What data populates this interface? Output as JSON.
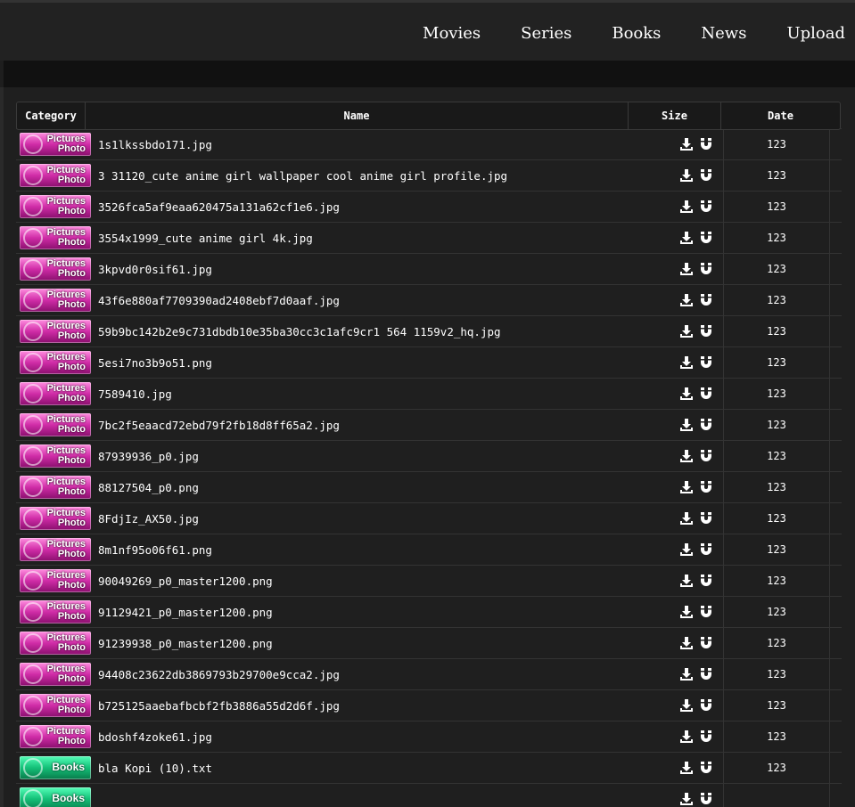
{
  "nav": {
    "items": [
      "Movies",
      "Series",
      "Books",
      "News",
      "Upload"
    ]
  },
  "table": {
    "headers": {
      "category": "Category",
      "name": "Name",
      "size": "Size",
      "date": "Date"
    },
    "badges": {
      "pictures": [
        "Pictures",
        "Photo"
      ],
      "books": "Books"
    },
    "rows": [
      {
        "category": "pictures",
        "name": "1s1lkssbdo171.jpg",
        "date": "123"
      },
      {
        "category": "pictures",
        "name": "3 31120_cute anime girl wallpaper cool anime girl profile.jpg",
        "date": "123"
      },
      {
        "category": "pictures",
        "name": "3526fca5af9eaa620475a131a62cf1e6.jpg",
        "date": "123"
      },
      {
        "category": "pictures",
        "name": "3554x1999_cute anime girl 4k.jpg",
        "date": "123"
      },
      {
        "category": "pictures",
        "name": "3kpvd0r0sif61.jpg",
        "date": "123"
      },
      {
        "category": "pictures",
        "name": "43f6e880af7709390ad2408ebf7d0aaf.jpg",
        "date": "123"
      },
      {
        "category": "pictures",
        "name": "59b9bc142b2e9c731dbdb10e35ba30cc3c1afc9cr1 564 1159v2_hq.jpg",
        "date": "123"
      },
      {
        "category": "pictures",
        "name": "5esi7no3b9o51.png",
        "date": "123"
      },
      {
        "category": "pictures",
        "name": "7589410.jpg",
        "date": "123"
      },
      {
        "category": "pictures",
        "name": "7bc2f5eaacd72ebd79f2fb18d8ff65a2.jpg",
        "date": "123"
      },
      {
        "category": "pictures",
        "name": "87939936_p0.jpg",
        "date": "123"
      },
      {
        "category": "pictures",
        "name": "88127504_p0.png",
        "date": "123"
      },
      {
        "category": "pictures",
        "name": "8FdjIz_AX50.jpg",
        "date": "123"
      },
      {
        "category": "pictures",
        "name": "8m1nf95o06f61.png",
        "date": "123"
      },
      {
        "category": "pictures",
        "name": "90049269_p0_master1200.png",
        "date": "123"
      },
      {
        "category": "pictures",
        "name": "91129421_p0_master1200.png",
        "date": "123"
      },
      {
        "category": "pictures",
        "name": "91239938_p0_master1200.png",
        "date": "123"
      },
      {
        "category": "pictures",
        "name": "94408c23622db3869793b29700e9cca2.jpg",
        "date": "123"
      },
      {
        "category": "pictures",
        "name": "b725125aaebafbcbf2fb3886a55d2d6f.jpg",
        "date": "123"
      },
      {
        "category": "pictures",
        "name": "bdoshf4zoke61.jpg",
        "date": "123"
      },
      {
        "category": "books",
        "name": "bla Kopi (10).txt",
        "date": "123"
      }
    ]
  },
  "icons": {
    "download": "download-icon",
    "magnet": "magnet-icon"
  }
}
